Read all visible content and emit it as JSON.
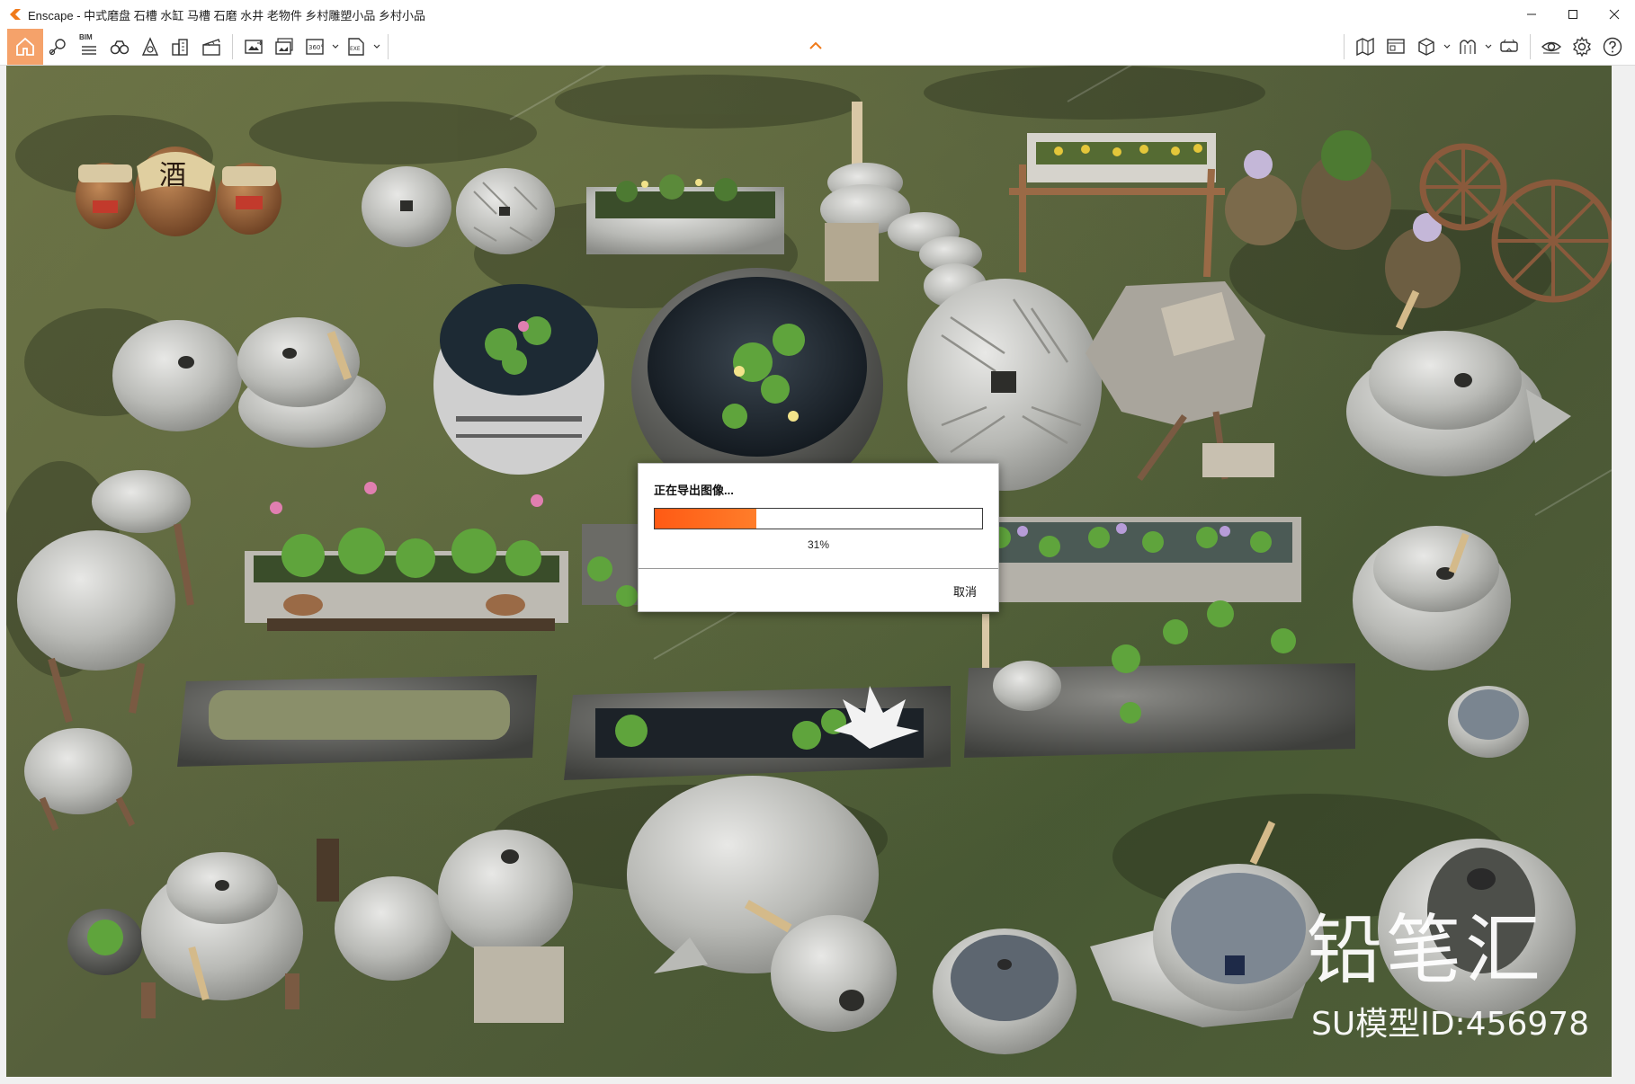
{
  "window": {
    "title": "Enscape - 中式磨盘 石槽 水缸 马槽 石磨 水井 老物件 乡村雕塑小品 乡村小品"
  },
  "toolbar": {
    "left_icons": [
      "home-icon",
      "location-pin-icon",
      "bim-icon",
      "binoculars-icon",
      "sun-house-icon",
      "buildings-icon",
      "clapperboard-icon"
    ],
    "export_icons": [
      "screenshot-export-icon",
      "batch-render-icon",
      "panorama-360-icon",
      "exe-export-icon"
    ],
    "right_icons": [
      "map-icon",
      "monitor-icon",
      "cube-icon",
      "material-icon",
      "vr-headset-icon",
      "eye-icon",
      "settings-icon",
      "help-icon"
    ],
    "bim_label": "BIM",
    "pano_label": "360°",
    "exe_label": "EXE"
  },
  "dialog": {
    "title": "正在导出图像...",
    "progress": 0.31,
    "progress_text": "31%",
    "cancel_label": "取消"
  },
  "watermark": {
    "brand": "铅笔汇",
    "model_id": "SU模型ID:456978",
    "jar_label": "酒"
  },
  "colors": {
    "accent": "#f07a1a",
    "progress": "#ff5a14",
    "grass": "#5a6240"
  }
}
